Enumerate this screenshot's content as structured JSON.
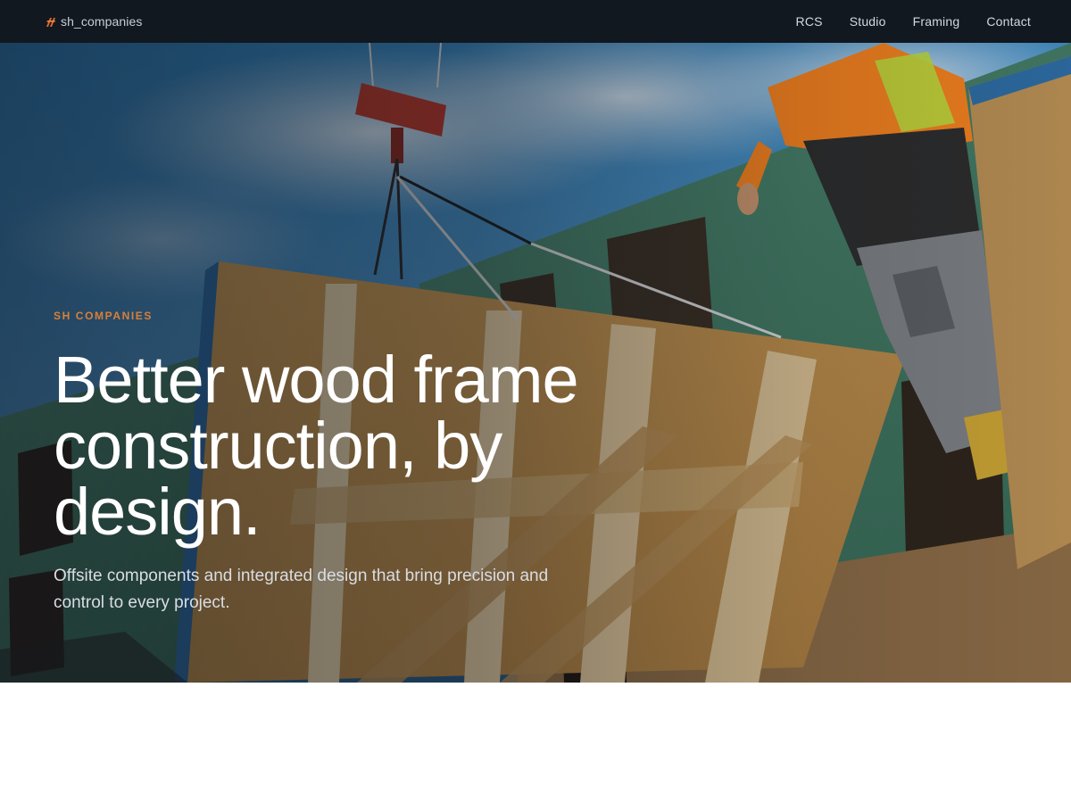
{
  "nav": {
    "brand_label": "sh_companies",
    "links": [
      "RCS",
      "Studio",
      "Framing",
      "Contact"
    ]
  },
  "hero": {
    "eyebrow": "SH COMPANIES",
    "headline": "Better wood frame construction, by design.",
    "subhead": "Offsite components and integrated design that bring precision and control to every project."
  },
  "colors": {
    "nav_background": "#121820",
    "accent": "#d9803a",
    "headline": "#ffffff",
    "page_background": "#ffffff"
  },
  "icons": {
    "brand": "sh-logo-mark-icon"
  }
}
